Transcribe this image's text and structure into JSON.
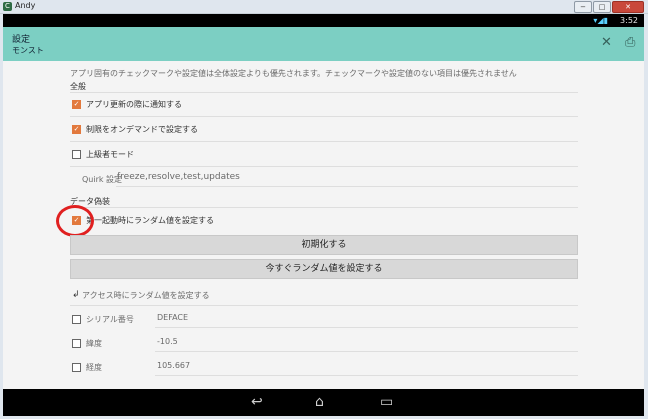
{
  "window": {
    "title": "Andy",
    "logo_glyph": "C",
    "btn_min": "−",
    "btn_max": "□",
    "btn_close": "✕"
  },
  "statusbar": {
    "time": "3:52",
    "signal_glyphs": "▾◢▮"
  },
  "actionbar": {
    "title": "設定",
    "subtitle": "モンスト",
    "close_glyph": "✕",
    "save_glyph": "⎙"
  },
  "content": {
    "notice": "アプリ固有のチェックマークや設定値は全体設定よりも優先されます。チェックマークや設定値のない項目は優先されません",
    "section_general": "全般",
    "items": [
      {
        "label": "アプリ更新の際に通知する",
        "checked": true
      },
      {
        "label": "制限をオンデマンドで設定する",
        "checked": true
      },
      {
        "label": "上級者モード",
        "checked": false
      }
    ],
    "quirk": {
      "label": "Quirk 設定",
      "value": "freeze,resolve,test,updates"
    },
    "section_data": "データ偽装",
    "random_first": {
      "label": "第一起動時にランダム値を設定する",
      "checked": true
    },
    "btn_init": "初期化する",
    "btn_random_now": "今すぐランダム値を設定する",
    "access_random": {
      "glyph": "↲",
      "label": "アクセス時にランダム値を設定する"
    },
    "fields": [
      {
        "label": "シリアル番号",
        "value": "DEFACE",
        "checked": false
      },
      {
        "label": "緯度",
        "value": "-10.5",
        "checked": false
      },
      {
        "label": "経度",
        "value": "105.667",
        "checked": false
      }
    ]
  },
  "navbar": {
    "back_glyph": "↩",
    "home_glyph": "⌂",
    "recent_glyph": "▭"
  },
  "colors": {
    "accent": "#7ccfc3",
    "checkbox": "#e2793d",
    "highlight_circle": "#e02020"
  }
}
